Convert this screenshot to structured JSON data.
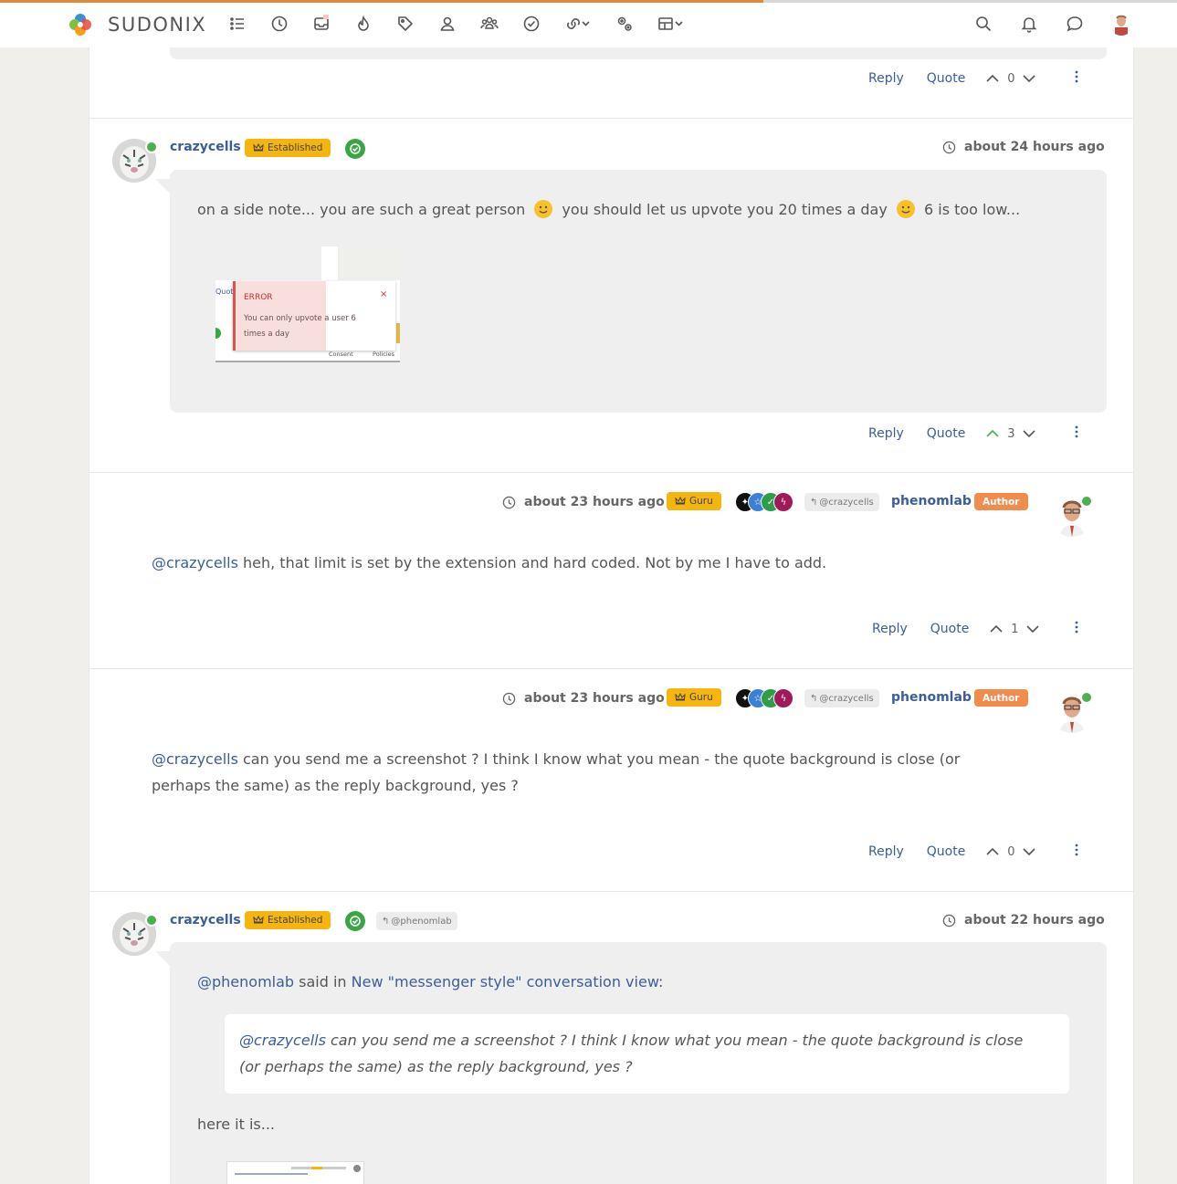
{
  "nav": {
    "brand": "SUDONIX",
    "icons": [
      "categories-icon",
      "recent-icon",
      "unread-icon",
      "popular-icon",
      "tags-icon",
      "user-icon",
      "groups-icon",
      "solved-icon",
      "links-icon",
      "settings-icon",
      "themes-icon"
    ],
    "right_icons": [
      "search-icon",
      "notifications-icon",
      "chat-icon"
    ]
  },
  "prev_post": {
    "reply": "Reply",
    "quote": "Quote",
    "votes": "0"
  },
  "post1": {
    "username": "crazycells",
    "rank": "Established",
    "time": "about 24 hours ago",
    "text_a": "on a side note... you are such a great person",
    "text_b": "you should let us upvote you 20 times a day",
    "text_c": "6 is too low...",
    "error_title": "ERROR",
    "error_line1": "You can only upvote a user 6",
    "error_line2": "times a day",
    "footer_a": "Consent",
    "footer_b": "Policies",
    "cut_label": "Quot",
    "reply": "Reply",
    "quote": "Quote",
    "votes": "3"
  },
  "post2": {
    "time": "about 23 hours ago",
    "rank": "Guru",
    "reply_to": "@crazycells",
    "username": "phenomlab",
    "author_badge": "Author",
    "mention": "@crazycells",
    "text": " heh, that limit is set by the extension and hard coded. Not by me I have to add.",
    "reply": "Reply",
    "quote": "Quote",
    "votes": "1"
  },
  "post3": {
    "time": "about 23 hours ago",
    "rank": "Guru",
    "reply_to": "@crazycells",
    "username": "phenomlab",
    "author_badge": "Author",
    "mention": "@crazycells",
    "text_l1": " can you send me a screenshot ? I think I know what you mean - the quote background is close (or",
    "text_l2": "perhaps the same) as the reply background, yes ?",
    "reply": "Reply",
    "quote": "Quote",
    "votes": "0"
  },
  "post4": {
    "username": "crazycells",
    "rank": "Established",
    "reply_to": "@phenomlab",
    "time": "about 22 hours ago",
    "quote_author": "@phenomlab",
    "said_in": " said in ",
    "topic_link": "New \"messenger style\" conversation view",
    "colon": ":",
    "quote_mention": "@crazycells",
    "quote_l1": " can you send me a screenshot ? I think I know what you mean - the quote background is close",
    "quote_l2": "(or perhaps the same) as the reply background, yes ?",
    "text": "here it is..."
  },
  "colors": {
    "accent": "#3a5d9c",
    "rank": "#f5b50f",
    "author": "#f28c4c",
    "online": "#4caf50",
    "progress": "#e08a3c"
  }
}
